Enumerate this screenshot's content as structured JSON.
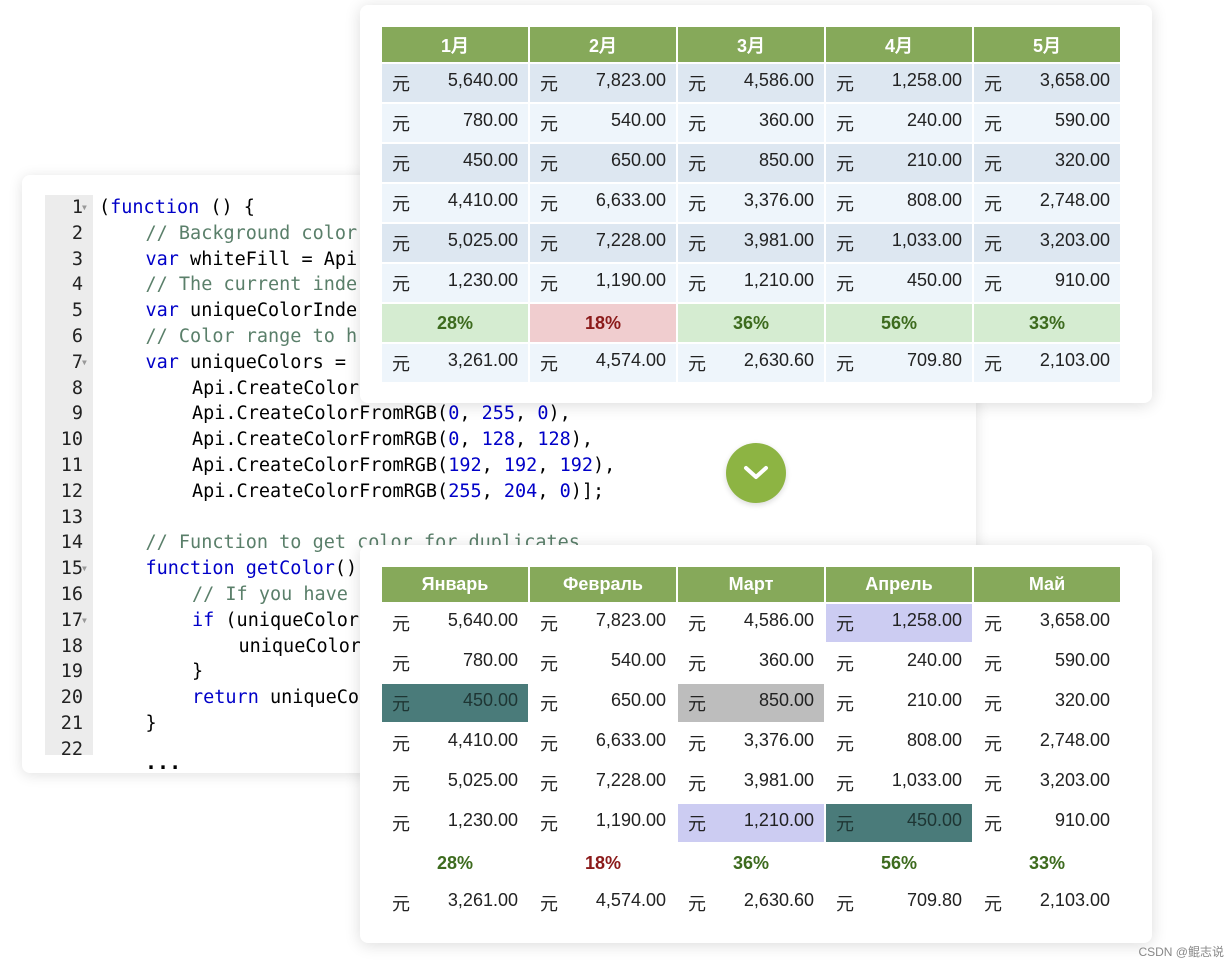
{
  "code": {
    "lines": [
      {
        "n": "1",
        "fold": true,
        "indent": 0,
        "seg": [
          [
            "tx",
            "("
          ],
          [
            "kw",
            "function"
          ],
          [
            "tx",
            " () {"
          ]
        ]
      },
      {
        "n": "2",
        "indent": 1,
        "seg": [
          [
            "cm",
            "// Background color"
          ]
        ]
      },
      {
        "n": "3",
        "indent": 1,
        "seg": [
          [
            "kw",
            "var"
          ],
          [
            "tx",
            " whiteFill = Api"
          ]
        ]
      },
      {
        "n": "4",
        "indent": 1,
        "seg": [
          [
            "cm",
            "// The current inde"
          ]
        ]
      },
      {
        "n": "5",
        "indent": 1,
        "seg": [
          [
            "kw",
            "var"
          ],
          [
            "tx",
            " uniqueColorInde"
          ]
        ]
      },
      {
        "n": "6",
        "indent": 1,
        "seg": [
          [
            "cm",
            "// Color range to h"
          ]
        ]
      },
      {
        "n": "7",
        "fold": true,
        "indent": 1,
        "seg": [
          [
            "kw",
            "var"
          ],
          [
            "tx",
            " uniqueColors ="
          ]
        ]
      },
      {
        "n": "8",
        "indent": 2,
        "seg": [
          [
            "tx",
            "Api.CreateColor"
          ]
        ]
      },
      {
        "n": "9",
        "indent": 2,
        "seg": [
          [
            "tx",
            "Api.CreateColorFromRGB("
          ],
          [
            "num",
            "0"
          ],
          [
            "tx",
            ", "
          ],
          [
            "num",
            "255"
          ],
          [
            "tx",
            ", "
          ],
          [
            "num",
            "0"
          ],
          [
            "tx",
            "),"
          ]
        ]
      },
      {
        "n": "10",
        "indent": 2,
        "seg": [
          [
            "tx",
            "Api.CreateColorFromRGB("
          ],
          [
            "num",
            "0"
          ],
          [
            "tx",
            ", "
          ],
          [
            "num",
            "128"
          ],
          [
            "tx",
            ", "
          ],
          [
            "num",
            "128"
          ],
          [
            "tx",
            "),"
          ]
        ]
      },
      {
        "n": "11",
        "indent": 2,
        "seg": [
          [
            "tx",
            "Api.CreateColorFromRGB("
          ],
          [
            "num",
            "192"
          ],
          [
            "tx",
            ", "
          ],
          [
            "num",
            "192"
          ],
          [
            "tx",
            ", "
          ],
          [
            "num",
            "192"
          ],
          [
            "tx",
            "),"
          ]
        ]
      },
      {
        "n": "12",
        "indent": 2,
        "seg": [
          [
            "tx",
            "Api.CreateColorFromRGB("
          ],
          [
            "num",
            "255"
          ],
          [
            "tx",
            ", "
          ],
          [
            "num",
            "204"
          ],
          [
            "tx",
            ", "
          ],
          [
            "num",
            "0"
          ],
          [
            "tx",
            ")];"
          ]
        ]
      },
      {
        "n": "13",
        "indent": 0,
        "seg": []
      },
      {
        "n": "14",
        "indent": 1,
        "seg": [
          [
            "cm",
            "// Function to get color for duplicates"
          ]
        ]
      },
      {
        "n": "15",
        "fold": true,
        "indent": 1,
        "seg": [
          [
            "kw",
            "function"
          ],
          [
            "tx",
            " "
          ],
          [
            "kw",
            "getColor"
          ],
          [
            "tx",
            "()"
          ]
        ]
      },
      {
        "n": "16",
        "indent": 2,
        "seg": [
          [
            "cm",
            "// If you have"
          ]
        ]
      },
      {
        "n": "17",
        "fold": true,
        "indent": 2,
        "seg": [
          [
            "kw",
            "if"
          ],
          [
            "tx",
            " (uniqueColor"
          ]
        ]
      },
      {
        "n": "18",
        "indent": 3,
        "seg": [
          [
            "tx",
            "uniqueColor"
          ]
        ]
      },
      {
        "n": "19",
        "indent": 2,
        "seg": [
          [
            "tx",
            "}"
          ]
        ]
      },
      {
        "n": "20",
        "indent": 2,
        "seg": [
          [
            "kw",
            "return"
          ],
          [
            "tx",
            " uniqueCo"
          ]
        ]
      },
      {
        "n": "21",
        "indent": 1,
        "seg": [
          [
            "tx",
            "}"
          ]
        ]
      },
      {
        "n": "22",
        "indent": 0,
        "seg": []
      }
    ],
    "ellipsis": "..."
  },
  "currency": "元",
  "top_table": {
    "headers": [
      "1月",
      "2月",
      "3月",
      "4月",
      "5月"
    ]
  },
  "bottom_table": {
    "headers": [
      "Январь",
      "Февраль",
      "Март",
      "Апрель",
      "Май"
    ]
  },
  "rows": [
    [
      "5,640.00",
      "7,823.00",
      "4,586.00",
      "1,258.00",
      "3,658.00"
    ],
    [
      "780.00",
      "540.00",
      "360.00",
      "240.00",
      "590.00"
    ],
    [
      "450.00",
      "650.00",
      "850.00",
      "210.00",
      "320.00"
    ],
    [
      "4,410.00",
      "6,633.00",
      "3,376.00",
      "808.00",
      "2,748.00"
    ],
    [
      "5,025.00",
      "7,228.00",
      "3,981.00",
      "1,033.00",
      "3,203.00"
    ],
    [
      "1,230.00",
      "1,190.00",
      "1,210.00",
      "450.00",
      "910.00"
    ],
    [
      "28%",
      "18%",
      "36%",
      "56%",
      "33%"
    ],
    [
      "3,261.00",
      "4,574.00",
      "2,630.60",
      "709.80",
      "2,103.00"
    ]
  ],
  "percent_row_negative": [
    false,
    true,
    false,
    false,
    false
  ],
  "bottom_highlights": {
    "0-3": "lav",
    "2-0": "teal",
    "2-2": "gray",
    "5-2": "lav",
    "5-3": "teal"
  },
  "colors": {
    "header": "#86a95a",
    "teal": "#4a7b7a",
    "gray": "#bdbdbd",
    "lavender": "#ccccf2",
    "chevron": "#8db443"
  },
  "chevron_icon": "chevron-down-icon",
  "watermark": "CSDN @鲲志说"
}
